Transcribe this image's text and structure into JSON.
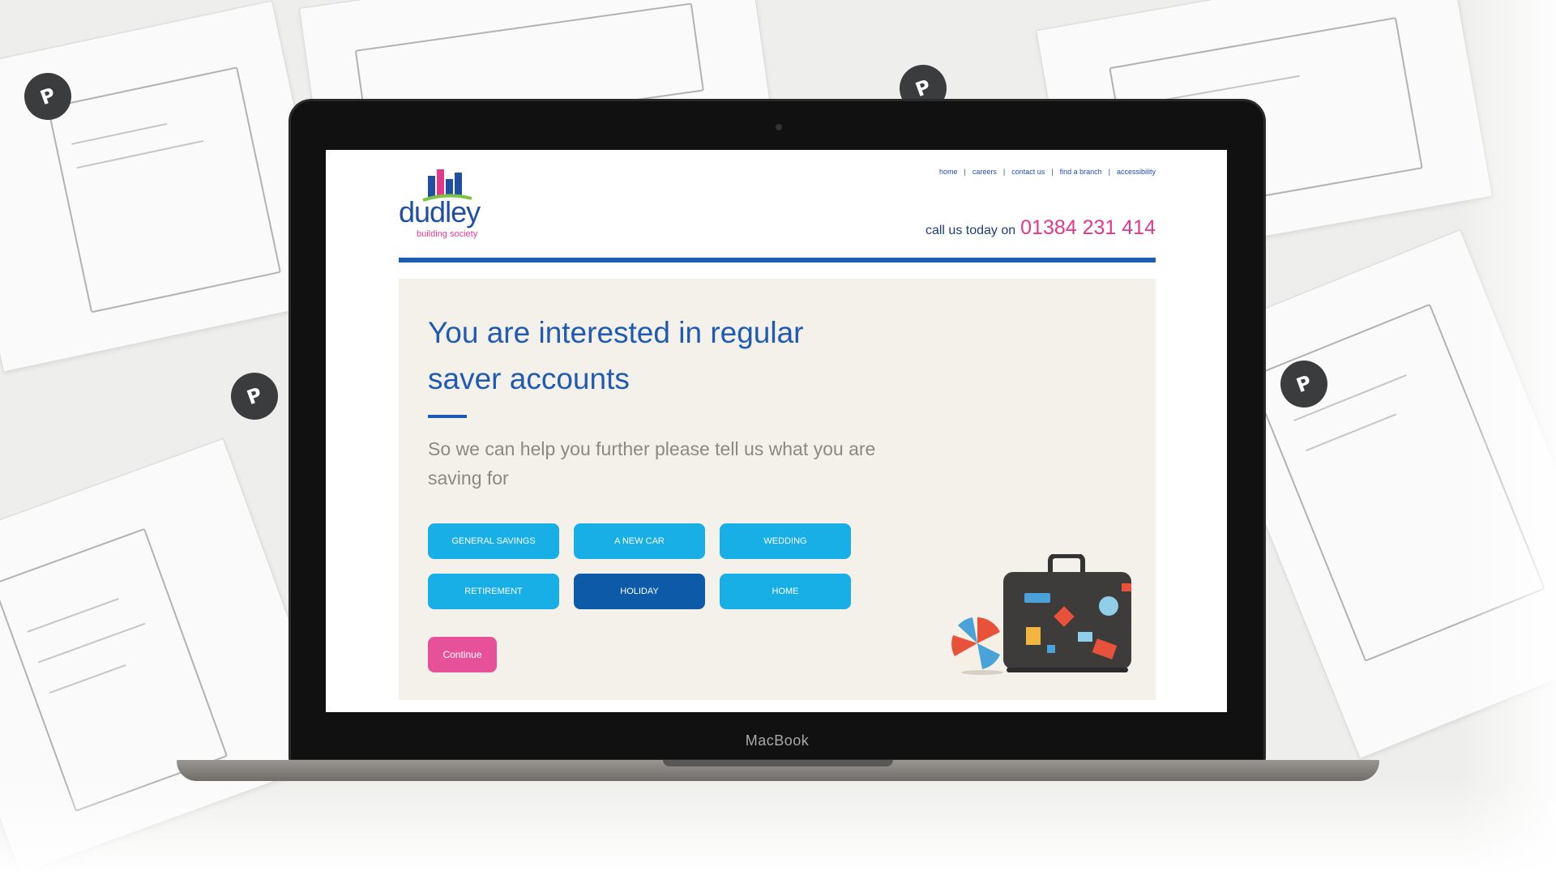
{
  "laptop": {
    "brand": "MacBook"
  },
  "site": {
    "logo": {
      "word": "dudley",
      "sub": "building society"
    },
    "nav": [
      "home",
      "careers",
      "contact us",
      "find a branch",
      "accessibility"
    ],
    "call": {
      "text": "call us today on",
      "phone": "01384 231 414"
    }
  },
  "panel": {
    "title": "You are interested in regular saver accounts",
    "subtitle": "So we can help you further please tell us what you are saving for",
    "options": [
      {
        "label": "GENERAL SAVINGS",
        "selected": false
      },
      {
        "label": "A NEW CAR",
        "selected": false
      },
      {
        "label": "WEDDING",
        "selected": false
      },
      {
        "label": "RETIREMENT",
        "selected": false
      },
      {
        "label": "HOLIDAY",
        "selected": true
      },
      {
        "label": "HOME",
        "selected": false
      }
    ],
    "continue_label": "Continue"
  },
  "colors": {
    "brand_blue": "#1f5bb3",
    "option_blue": "#18aee6",
    "selected_blue": "#0c5aa8",
    "accent_pink": "#e2388a",
    "panel_bg": "#f4f1ea"
  }
}
